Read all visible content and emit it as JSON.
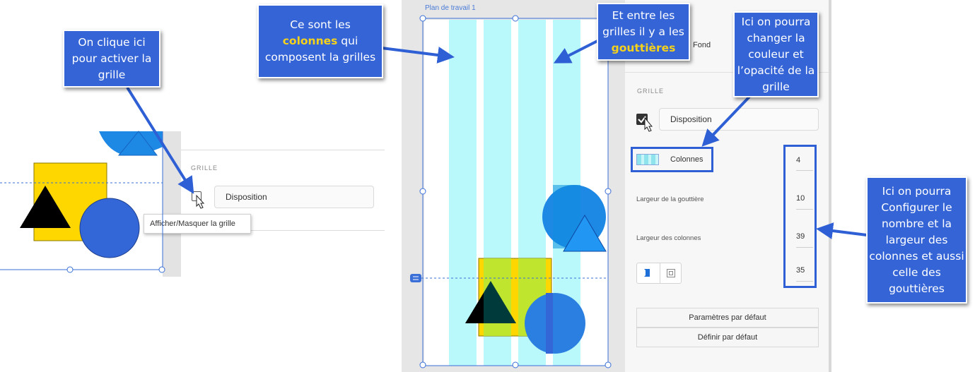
{
  "callouts": {
    "activate": "On clique ici pour activer la grille",
    "columns": {
      "pre": "Ce sont les",
      "highlight": "colonnes",
      "post": "qui composent la grilles"
    },
    "gutters": {
      "pre": "Et entre les grilles il y a les",
      "highlight": "gouttières"
    },
    "color": "Ici on pourra changer la couleur et l’opacité de la grille",
    "configure": "Ici on pourra Configurer le nombre et la largeur des colonnes et aussi celle des gouttières"
  },
  "left_panel": {
    "section_title": "GRILLE",
    "layout_field": "Disposition",
    "tooltip": "Afficher/Masquer la grille"
  },
  "artboard": {
    "title": "Plan de travail 1"
  },
  "right_panel": {
    "fond_label": "Fond",
    "section_title": "GRILLE",
    "layout_field": "Disposition",
    "columns_label": "Colonnes",
    "columns_value": "4",
    "gutter_label": "Largeur de la gouttière",
    "gutter_value": "10",
    "column_width_label": "Largeur des colonnes",
    "column_width_value": "39",
    "margin_value": "35",
    "defaults_button": "Paramètres par défaut",
    "set_default_button": "Définir par défaut"
  },
  "colors": {
    "callout": "#3464d6",
    "highlight": "#f7d21a",
    "grid_column": "#b9f9fb",
    "shape_blue": "#3366d6",
    "shape_yellow": "#ffd700",
    "selection": "#3a6fd8"
  }
}
